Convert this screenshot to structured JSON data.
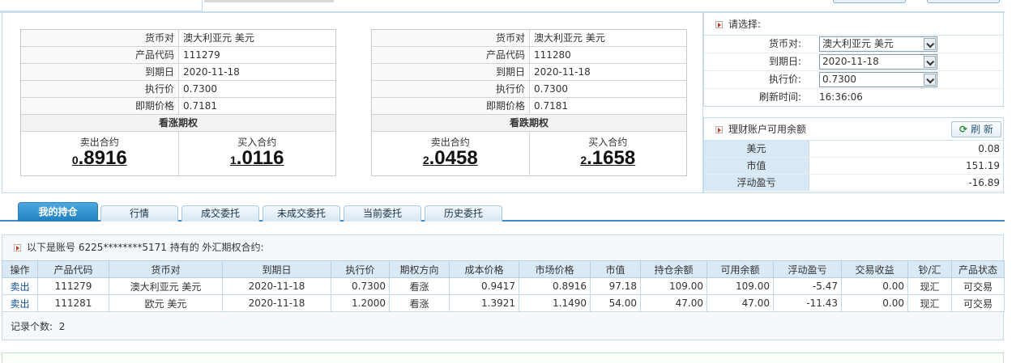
{
  "quotes": [
    {
      "rows": [
        {
          "label": "货币对",
          "value": "澳大利亚元 美元"
        },
        {
          "label": "产品代码",
          "value": "111279"
        },
        {
          "label": "到期日",
          "value": "2020-11-18"
        },
        {
          "label": "执行价",
          "value": "0.7300"
        },
        {
          "label": "即期价格",
          "value": "0.7181"
        }
      ],
      "title": "看涨期权",
      "sell_label": "卖出合约",
      "sell_int": "0",
      "sell_dec": ".8916",
      "buy_label": "买入合约",
      "buy_int": "1",
      "buy_dec": ".0116"
    },
    {
      "rows": [
        {
          "label": "货币对",
          "value": "澳大利亚元 美元"
        },
        {
          "label": "产品代码",
          "value": "111280"
        },
        {
          "label": "到期日",
          "value": "2020-11-18"
        },
        {
          "label": "执行价",
          "value": "0.7300"
        },
        {
          "label": "即期价格",
          "value": "0.7181"
        }
      ],
      "title": "看跌期权",
      "sell_label": "卖出合约",
      "sell_int": "2",
      "sell_dec": ".0458",
      "buy_label": "买入合约",
      "buy_int": "2",
      "buy_dec": ".1658"
    }
  ],
  "selection": {
    "title": "请选择:",
    "currency_label": "货币对:",
    "currency_value": "澳大利亚元 美元",
    "expiry_label": "到期日:",
    "expiry_value": "2020-11-18",
    "strike_label": "执行价:",
    "strike_value": "0.7300",
    "refresh_time_label": "刷新时间:",
    "refresh_time_value": "16:36:06"
  },
  "balance": {
    "title": "理财账户可用余额",
    "refresh_label": "刷 新",
    "rows": [
      {
        "label": "美元",
        "value": "0.08"
      },
      {
        "label": "市值",
        "value": "151.19"
      },
      {
        "label": "浮动盈亏",
        "value": "-16.89"
      }
    ]
  },
  "tabs": [
    "我的持仓",
    "行情",
    "成交委托",
    "未成交委托",
    "当前委托",
    "历史委托"
  ],
  "holdings": {
    "caption": "以下是账号 6225********5171 持有的 外汇期权合约:",
    "columns": [
      "操作",
      "产品代码",
      "货币对",
      "到期日",
      "执行价",
      "期权方向",
      "成本价格",
      "市场价格",
      "市值",
      "持仓余额",
      "可用余额",
      "浮动盈亏",
      "交易收益",
      "钞/汇",
      "产品状态"
    ],
    "rows": [
      [
        "卖出",
        "111279",
        "澳大利亚元 美元",
        "2020-11-18",
        "0.7300",
        "看涨",
        "0.9417",
        "0.8916",
        "97.18",
        "109.00",
        "109.00",
        "-5.47",
        "0.00",
        "现汇",
        "可交易"
      ],
      [
        "卖出",
        "111281",
        "欧元 美元",
        "2020-11-18",
        "1.2000",
        "看涨",
        "1.3921",
        "1.1490",
        "54.00",
        "47.00",
        "47.00",
        "-11.43",
        "0.00",
        "现汇",
        "可交易"
      ]
    ],
    "record_count_label": "记录个数:",
    "record_count": "2"
  }
}
